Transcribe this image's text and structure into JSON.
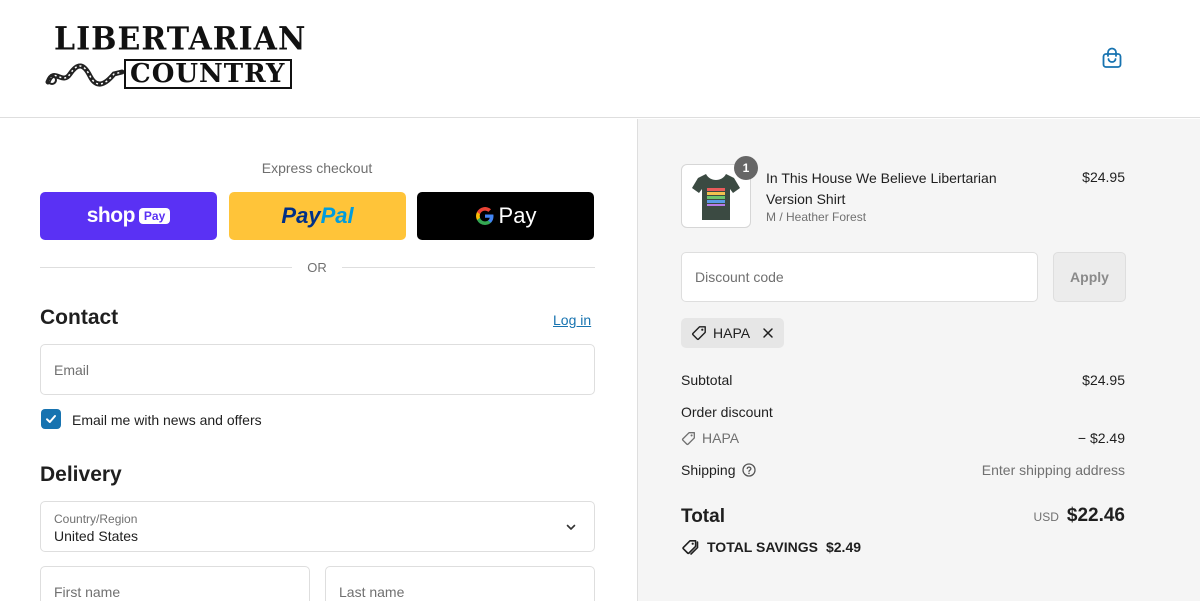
{
  "header": {
    "logo_line1": "LIBERTARIAN",
    "logo_line2": "COUNTRY",
    "cart_icon": "shopping-bag-icon"
  },
  "express": {
    "title": "Express checkout",
    "shop_pay": {
      "word": "shop",
      "pill": "Pay"
    },
    "paypal": {
      "part_a": "Pay",
      "part_b": "Pal"
    },
    "gpay": {
      "word": "Pay"
    },
    "or_text": "OR"
  },
  "contact": {
    "title": "Contact",
    "login_label": "Log in",
    "email_placeholder": "Email",
    "newsletter_label": "Email me with news and offers",
    "newsletter_checked": true
  },
  "delivery": {
    "title": "Delivery",
    "country_label": "Country/Region",
    "country_value": "United States",
    "first_name_placeholder": "First name",
    "last_name_placeholder": "Last name"
  },
  "summary": {
    "product": {
      "quantity": "1",
      "name": "In This House We Believe Libertarian Version Shirt",
      "variant": "M / Heather Forest",
      "price": "$24.95"
    },
    "discount_placeholder": "Discount code",
    "apply_label": "Apply",
    "applied_code": "HAPA",
    "subtotal_label": "Subtotal",
    "subtotal_value": "$24.95",
    "order_discount_label": "Order discount",
    "discount_code": "HAPA",
    "discount_value": "− $2.49",
    "shipping_label": "Shipping",
    "shipping_value": "Enter shipping address",
    "total_label": "Total",
    "total_currency": "USD",
    "total_value": "$22.46",
    "savings_label": "TOTAL SAVINGS",
    "savings_value": "$2.49"
  },
  "colors": {
    "accent": "#1773b0",
    "shop_pay": "#5a31f4",
    "paypal": "#ffc439",
    "gpay": "#000000",
    "summary_bg": "#f5f5f5"
  }
}
